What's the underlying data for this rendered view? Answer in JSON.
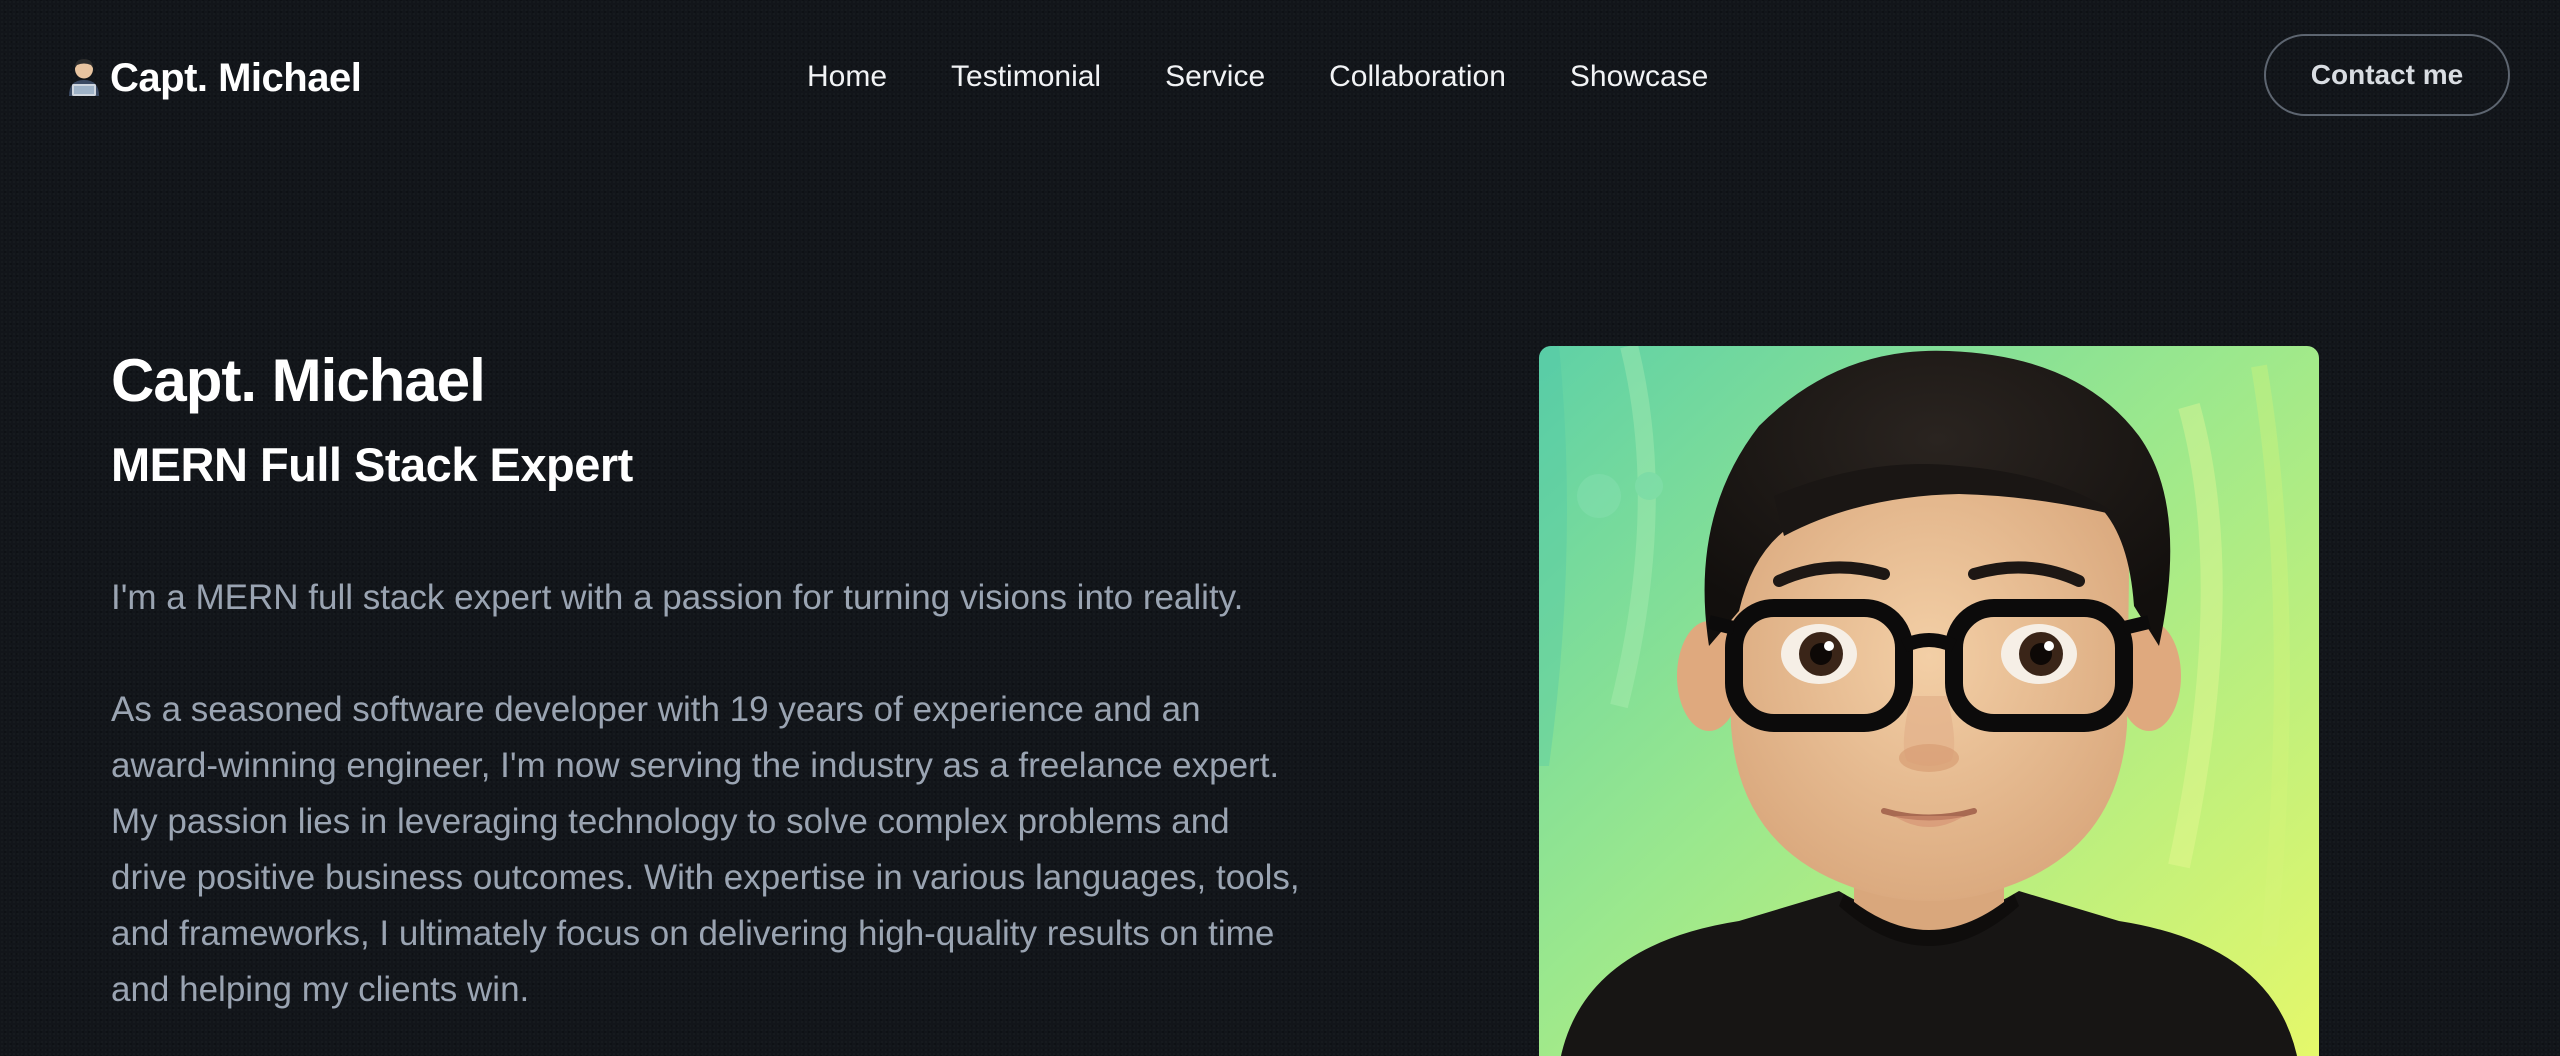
{
  "header": {
    "brand_icon": "technologist-emoji-icon",
    "brand_name": "Capt. Michael",
    "nav": [
      {
        "label": "Home"
      },
      {
        "label": "Testimonial"
      },
      {
        "label": "Service"
      },
      {
        "label": "Collaboration"
      },
      {
        "label": "Showcase"
      }
    ],
    "contact_label": "Contact me"
  },
  "hero": {
    "name": "Capt. Michael",
    "role": "MERN Full Stack Expert",
    "intro": "I'm a MERN full stack expert with a passion for turning visions into reality.",
    "bio": "As a seasoned software developer with 19 years of experience and an award-winning engineer, I'm now serving the industry as a freelance expert. My passion lies in leveraging technology to solve complex problems and drive positive business outcomes. With expertise in various languages, tools, and frameworks, I ultimately focus on delivering high-quality results on time and helping my clients win."
  },
  "colors": {
    "background": "#12151a",
    "text_primary": "#ffffff",
    "text_muted": "#9aa4b2",
    "button_border": "#5d6570",
    "avatar_bg_green": "#7ee0a0",
    "avatar_bg_yellow": "#e4f76a"
  }
}
